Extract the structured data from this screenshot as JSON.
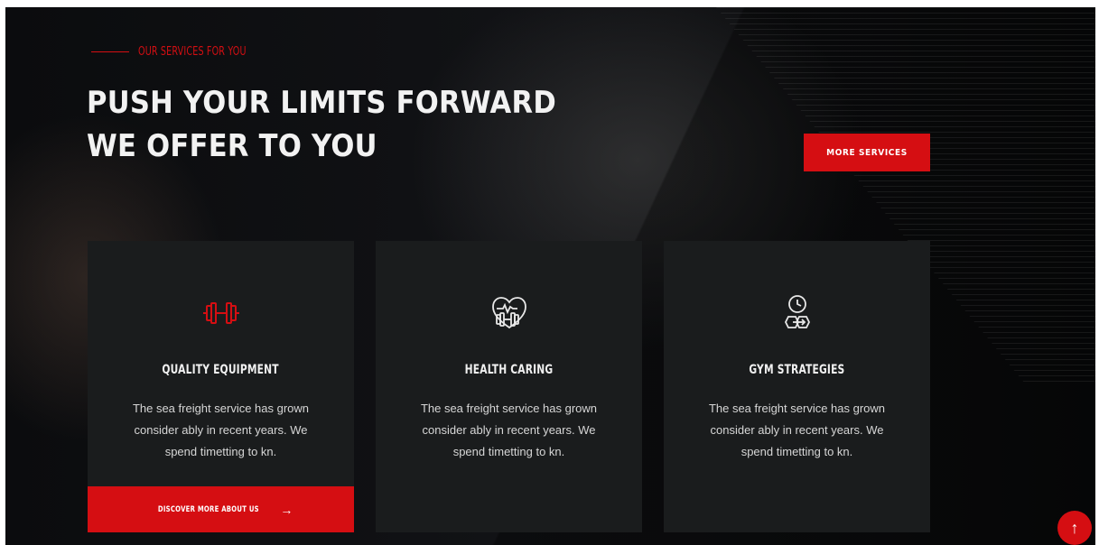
{
  "section": {
    "eyebrow": "OUR SERVICES FOR YOU",
    "headline_line1": "PUSH YOUR LIMITS FORWARD",
    "headline_line2": "WE OFFER TO YOU",
    "more_button": "MORE SERVICES"
  },
  "cards": [
    {
      "icon": "dumbbell-icon",
      "title": "QUALITY EQUIPMENT",
      "description": "The sea freight service has grown consider ably in recent years. We spend timetting to kn.",
      "cta_label": "DISCOVER MORE ABOUT US",
      "cta_arrow": "→"
    },
    {
      "icon": "heart-dumbbell-icon",
      "title": "HEALTH CARING",
      "description": "The sea freight service has grown consider ably in recent years. We spend timetting to kn."
    },
    {
      "icon": "clock-chain-icon",
      "title": "GYM STRATEGIES",
      "description": "The sea freight service has grown consider ably in recent years. We spend timetting to kn."
    }
  ],
  "scroll_top": {
    "glyph": "↑"
  },
  "colors": {
    "accent": "#d50e12",
    "card_bg": "#1a1c1d",
    "heading": "#f2f2f2",
    "body_text": "#d6d6d6"
  }
}
